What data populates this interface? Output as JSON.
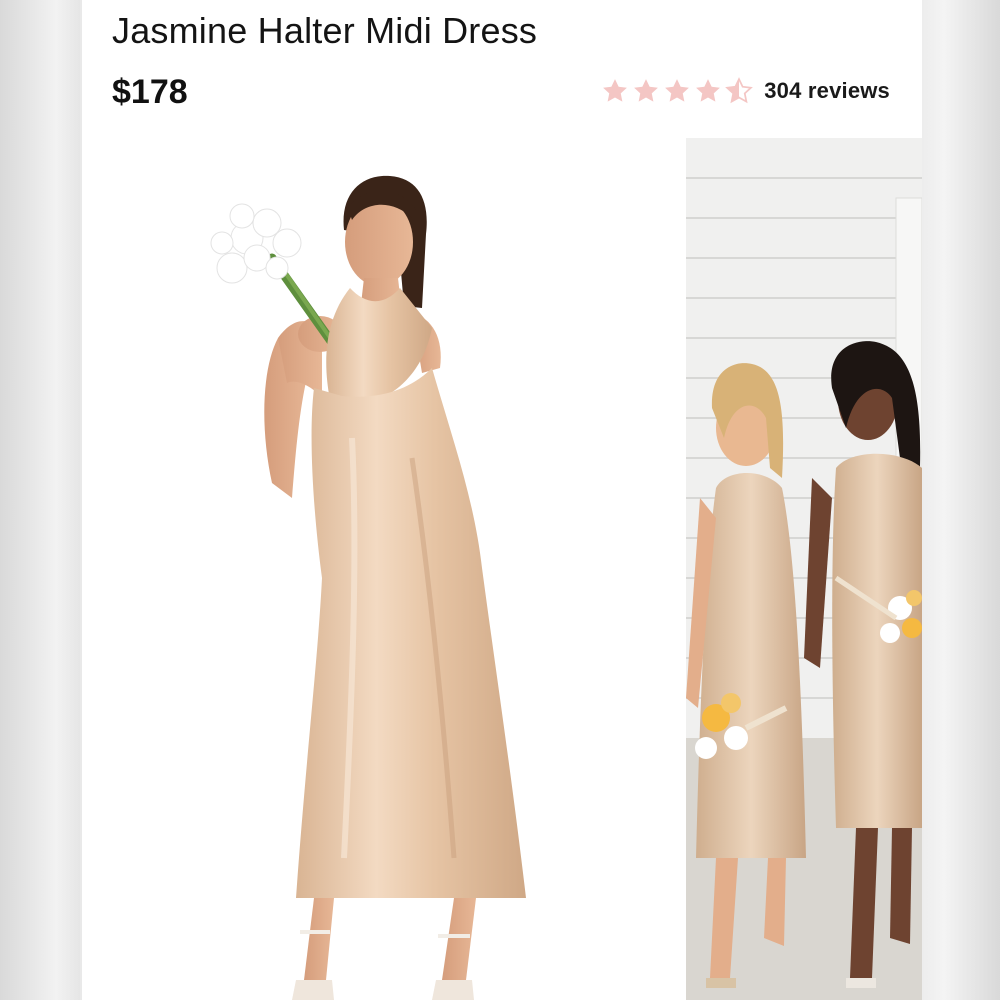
{
  "product": {
    "title": "Jasmine Halter Midi Dress",
    "price": "$178",
    "rating": {
      "value": 4.5,
      "max": 5,
      "reviews_label": "304 reviews",
      "star_color": "#f4c6c4"
    }
  },
  "gallery": {
    "images": [
      {
        "name": "model-holding-bouquet"
      },
      {
        "name": "bridesmaids-outdoors"
      }
    ]
  },
  "colors": {
    "dress": "#e9c8a8",
    "background": "#ffffff"
  }
}
